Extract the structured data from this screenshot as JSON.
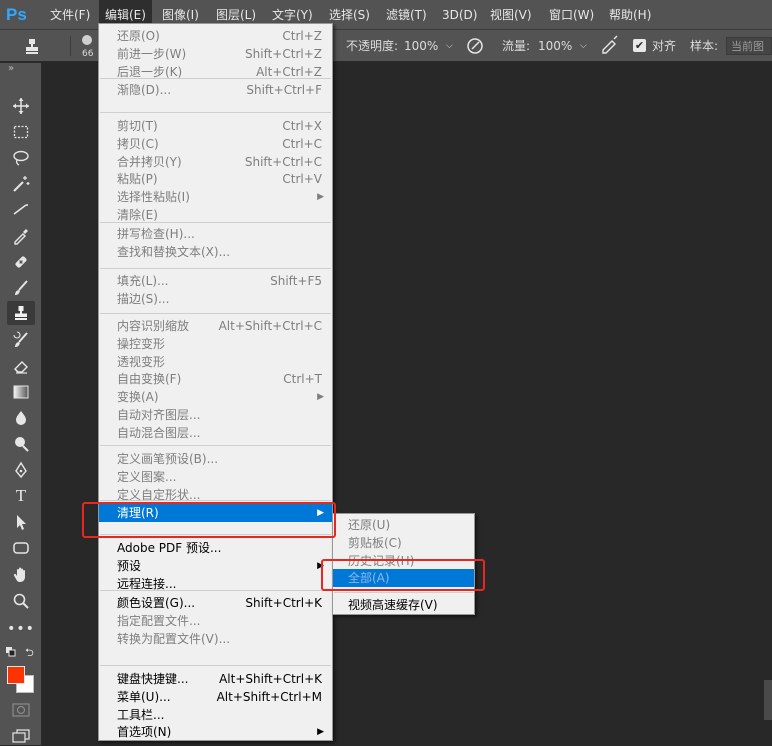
{
  "app": {
    "logo": "Ps"
  },
  "menubar": [
    "文件(F)",
    "编辑(E)",
    "图像(I)",
    "图层(L)",
    "文字(Y)",
    "选择(S)",
    "滤镜(T)",
    "3D(D)",
    "视图(V)",
    "窗口(W)",
    "帮助(H)"
  ],
  "options": {
    "brush_size": "66",
    "opacity_label": "不透明度:",
    "opacity_value": "100%",
    "flow_label": "流量:",
    "flow_value": "100%",
    "align_label": "对齐",
    "sample_label": "样本:",
    "sample_value": "当前图"
  },
  "toolbar": {
    "collapse": "»"
  },
  "edit_menu": {
    "items": [
      {
        "label": "还原(O)",
        "shortcut": "Ctrl+Z",
        "state": "dis"
      },
      {
        "label": "前进一步(W)",
        "shortcut": "Shift+Ctrl+Z",
        "state": "dis"
      },
      {
        "label": "后退一步(K)",
        "shortcut": "Alt+Ctrl+Z",
        "state": "dis"
      },
      {
        "label": "渐隐(D)...",
        "shortcut": "Shift+Ctrl+F",
        "state": "dis"
      },
      {
        "label": "剪切(T)",
        "shortcut": "Ctrl+X",
        "state": "dis"
      },
      {
        "label": "拷贝(C)",
        "shortcut": "Ctrl+C",
        "state": "dis"
      },
      {
        "label": "合并拷贝(Y)",
        "shortcut": "Shift+Ctrl+C",
        "state": "dis"
      },
      {
        "label": "粘贴(P)",
        "shortcut": "Ctrl+V",
        "state": "dis"
      },
      {
        "label": "选择性粘贴(I)",
        "shortcut": "",
        "state": "dis",
        "submenu": true
      },
      {
        "label": "清除(E)",
        "shortcut": "",
        "state": "dis"
      },
      {
        "label": "拼写检查(H)...",
        "shortcut": "",
        "state": "dis"
      },
      {
        "label": "查找和替换文本(X)...",
        "shortcut": "",
        "state": "dis"
      },
      {
        "label": "填充(L)...",
        "shortcut": "Shift+F5",
        "state": "dis"
      },
      {
        "label": "描边(S)...",
        "shortcut": "",
        "state": "dis"
      },
      {
        "label": "内容识别缩放",
        "shortcut": "Alt+Shift+Ctrl+C",
        "state": "dis"
      },
      {
        "label": "操控变形",
        "shortcut": "",
        "state": "dis"
      },
      {
        "label": "透视变形",
        "shortcut": "",
        "state": "dis"
      },
      {
        "label": "自由变换(F)",
        "shortcut": "Ctrl+T",
        "state": "dis"
      },
      {
        "label": "变换(A)",
        "shortcut": "",
        "state": "dis",
        "submenu": true
      },
      {
        "label": "自动对齐图层...",
        "shortcut": "",
        "state": "dis"
      },
      {
        "label": "自动混合图层...",
        "shortcut": "",
        "state": "dis"
      },
      {
        "label": "定义画笔预设(B)...",
        "shortcut": "",
        "state": "dis"
      },
      {
        "label": "定义图案...",
        "shortcut": "",
        "state": "dis"
      },
      {
        "label": "定义自定形状...",
        "shortcut": "",
        "state": "dis"
      },
      {
        "label": "清理(R)",
        "shortcut": "",
        "state": "hl",
        "submenu": true
      },
      {
        "label": "Adobe PDF 预设...",
        "shortcut": "",
        "state": "en"
      },
      {
        "label": "预设",
        "shortcut": "",
        "state": "en",
        "submenu": true
      },
      {
        "label": "远程连接...",
        "shortcut": "",
        "state": "en"
      },
      {
        "label": "颜色设置(G)...",
        "shortcut": "Shift+Ctrl+K",
        "state": "en"
      },
      {
        "label": "指定配置文件...",
        "shortcut": "",
        "state": "dis"
      },
      {
        "label": "转换为配置文件(V)...",
        "shortcut": "",
        "state": "dis"
      },
      {
        "label": "键盘快捷键...",
        "shortcut": "Alt+Shift+Ctrl+K",
        "state": "en"
      },
      {
        "label": "菜单(U)...",
        "shortcut": "Alt+Shift+Ctrl+M",
        "state": "en"
      },
      {
        "label": "工具栏...",
        "shortcut": "",
        "state": "en"
      },
      {
        "label": "首选项(N)",
        "shortcut": "",
        "state": "en",
        "submenu": true
      }
    ]
  },
  "purge_menu": {
    "items": [
      {
        "label": "还原(U)",
        "state": "dis"
      },
      {
        "label": "剪贴板(C)",
        "state": "dis"
      },
      {
        "label": "历史记录(H)",
        "state": "dis"
      },
      {
        "label": "全部(A)",
        "state": "hl-dis"
      },
      {
        "label": "视频高速缓存(V)",
        "state": "en"
      }
    ]
  },
  "colors": {
    "foreground": "#ff3300",
    "background": "#ffffff",
    "highlight": "#0078d7",
    "callout": "#e8281e"
  }
}
